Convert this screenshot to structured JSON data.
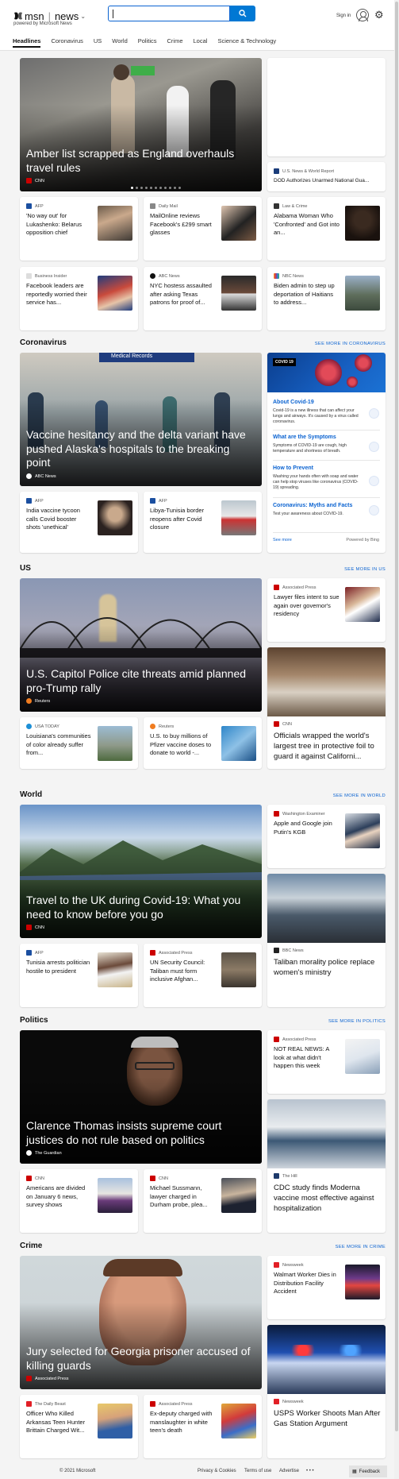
{
  "header": {
    "brand": "msn",
    "section_menu": "news",
    "powered_by": "powered by Microsoft News",
    "search_value": "",
    "signin": "Sign in"
  },
  "nav": [
    {
      "label": "Headlines",
      "active": true
    },
    {
      "label": "Coronavirus"
    },
    {
      "label": "US"
    },
    {
      "label": "World"
    },
    {
      "label": "Politics"
    },
    {
      "label": "Crime"
    },
    {
      "label": "Local"
    },
    {
      "label": "Science & Technology"
    }
  ],
  "headlines": {
    "hero": {
      "title": "Amber list scrapped as England overhauls travel rules",
      "source": "CNN"
    },
    "side": {
      "source": "U.S. News & World Report",
      "title": "DOD Authorizes Unarmed National Gua..."
    },
    "row1": [
      {
        "source": "AFP",
        "title": "'No way out' for Lukashenko: Belarus opposition chief"
      },
      {
        "source": "Daily Mail",
        "title": "MailOnline reviews Facebook's £299 smart glasses"
      },
      {
        "source": "Law & Crime",
        "title": "Alabama Woman Who 'Confronted' and Got into an..."
      }
    ],
    "row2": [
      {
        "source": "Business Insider",
        "title": "Facebook leaders are reportedly worried their service has..."
      },
      {
        "source": "ABC News",
        "title": "NYC hostess assaulted after asking Texas patrons for proof of..."
      },
      {
        "source": "NBC News",
        "title": "Biden admin to step up deportation of Haitians to address..."
      }
    ]
  },
  "coronavirus": {
    "heading": "Coronavirus",
    "more": "SEE MORE IN CORONAVIRUS",
    "hero": {
      "title": "Vaccine hesitancy and the delta variant have pushed Alaska's hospitals to the breaking point",
      "source": "ABC News",
      "sign": "Medical Records"
    },
    "covid_card": {
      "badge": "COVID 19",
      "items": [
        {
          "head": "About Covid-19",
          "text": "Covid-19 is a new illness that can affect your lungs and airways. It's caused by a virus called coronavirus."
        },
        {
          "head": "What are the Symptoms",
          "text": "Symptoms of COVID-19 are cough, high temperature and shortness of breath."
        },
        {
          "head": "How to Prevent",
          "text": "Washing your hands often with soap and water can help stop viruses like coronavirus (COVID-19) spreading."
        },
        {
          "head": "Coronavirus: Myths and Facts",
          "text": "Test your awareness about COVID-19."
        }
      ],
      "see_more": "See more",
      "powered": "Powered by Bing"
    },
    "row": [
      {
        "source": "AFP",
        "title": "India vaccine tycoon calls Covid booster shots 'unethical'"
      },
      {
        "source": "AFP",
        "title": "Libya-Tunisia border reopens after Covid closure"
      }
    ]
  },
  "us": {
    "heading": "US",
    "more": "SEE MORE IN US",
    "hero": {
      "title": "U.S. Capitol Police cite threats amid planned pro-Trump rally",
      "source": "Reuters"
    },
    "side1": {
      "source": "Associated Press",
      "title": "Lawyer files intent to sue again over governor's residency"
    },
    "side2": {
      "source": "CNN",
      "title": "Officials wrapped the world's largest tree in protective foil to guard it against Californi..."
    },
    "row": [
      {
        "source": "USA TODAY",
        "title": "Louisiana's communities of color already suffer from..."
      },
      {
        "source": "Reuters",
        "title": "U.S. to buy millions of Pfizer vaccine doses to donate to world -..."
      }
    ]
  },
  "world": {
    "heading": "World",
    "more": "SEE MORE IN WORLD",
    "hero": {
      "title": "Travel to the UK during Covid-19: What you need to know before you go",
      "source": "CNN"
    },
    "side1": {
      "source": "Washington Examiner",
      "title": "Apple and Google join Putin's KGB"
    },
    "side2": {
      "source": "BBC News",
      "title": "Taliban morality police replace women's ministry"
    },
    "row": [
      {
        "source": "AFP",
        "title": "Tunisia arrests politician hostile to president"
      },
      {
        "source": "Associated Press",
        "title": "UN Security Council: Taliban must form inclusive Afghan..."
      }
    ]
  },
  "politics": {
    "heading": "Politics",
    "more": "SEE MORE IN POLITICS",
    "hero": {
      "title": "Clarence Thomas insists supreme court justices do not rule based on politics",
      "source": "The Guardian"
    },
    "side1": {
      "source": "Associated Press",
      "title": "NOT REAL NEWS: A look at what didn't happen this week"
    },
    "side2": {
      "source": "The Hill",
      "title": "CDC study finds Moderna vaccine most effective against hospitalization"
    },
    "row": [
      {
        "source": "CNN",
        "title": "Americans are divided on January 6 news, survey shows"
      },
      {
        "source": "CNN",
        "title": "Michael Sussmann, lawyer charged in Durham probe, plea..."
      }
    ]
  },
  "crime": {
    "heading": "Crime",
    "more": "SEE MORE IN CRIME",
    "hero": {
      "title": "Jury selected for Georgia prisoner accused of killing guards",
      "source": "Associated Press"
    },
    "side1": {
      "source": "Newsweek",
      "title": "Walmart Worker Dies in Distribution Facility Accident"
    },
    "side2": {
      "source": "Newsweek",
      "title": "USPS Worker Shoots Man After Gas Station Argument"
    },
    "row": [
      {
        "source": "The Daily Beast",
        "title": "Officer Who Killed Arkansas Teen Hunter Brittain Charged Wit..."
      },
      {
        "source": "Associated Press",
        "title": "Ex-deputy charged with manslaughter in white teen's death"
      }
    ]
  },
  "footer": {
    "copyright": "© 2021 Microsoft",
    "privacy": "Privacy & Cookies",
    "terms": "Terms of use",
    "advertise": "Advertise",
    "more": "• • •",
    "feedback": "Feedback"
  },
  "colors": {
    "accent": "#0078d4",
    "link": "#0b63d1",
    "cnn_red": "#cc0000"
  }
}
